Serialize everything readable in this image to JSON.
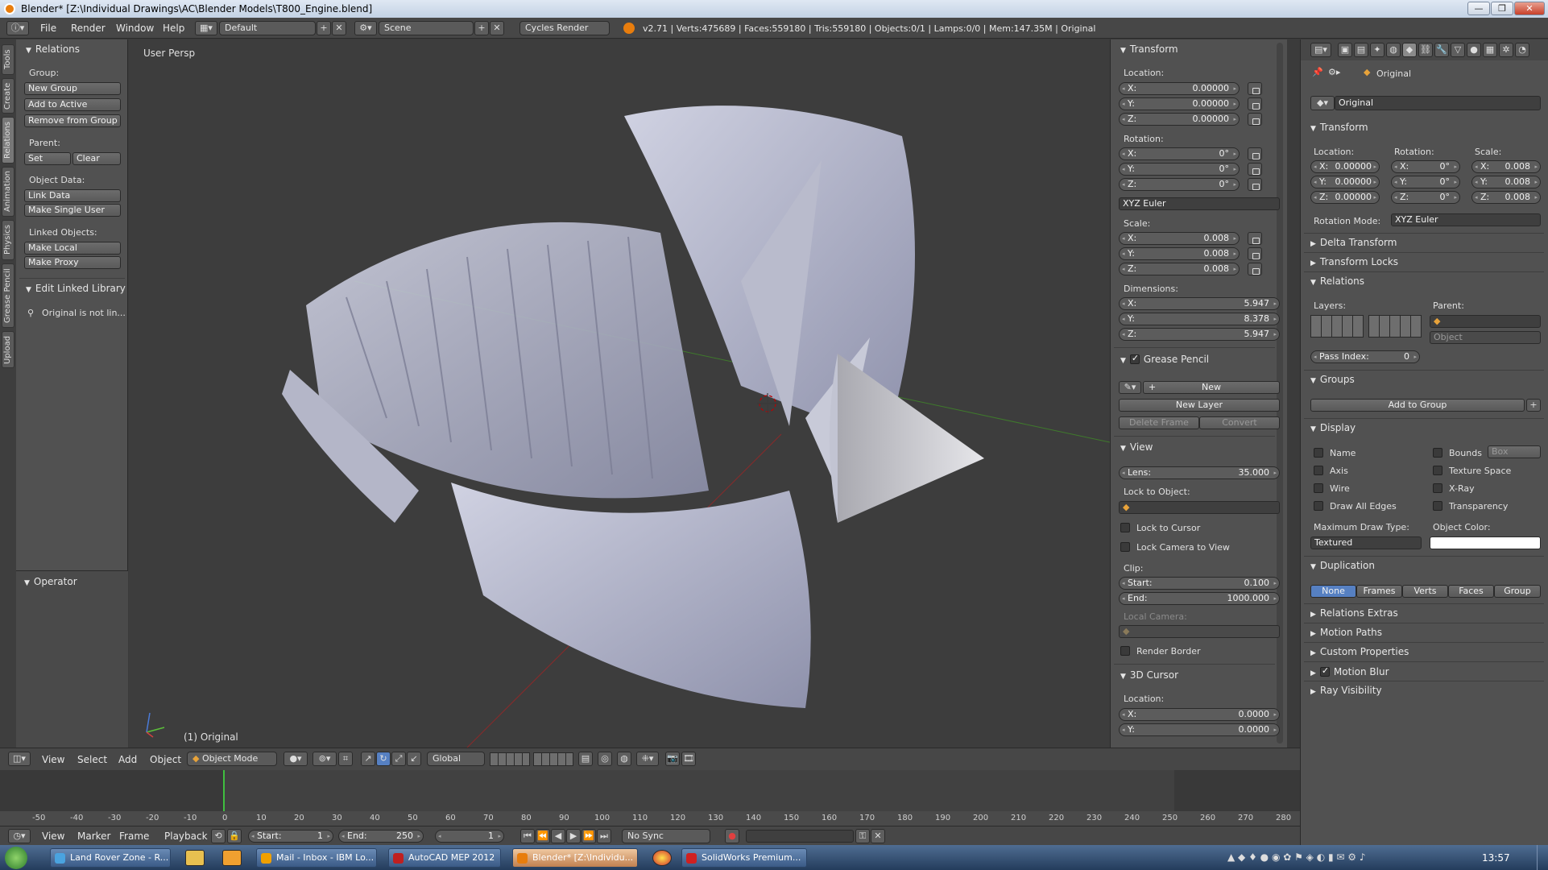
{
  "window": {
    "title": "Blender* [Z:\\Individual Drawings\\AC\\Blender Models\\T800_Engine.blend]"
  },
  "menubar": {
    "menus": [
      "File",
      "Render",
      "Window",
      "Help"
    ],
    "layout": "Default",
    "scene": "Scene",
    "engine": "Cycles Render",
    "stats": "v2.71 | Verts:475689 | Faces:559180 | Tris:559180 | Objects:0/1 | Lamps:0/0 | Mem:147.35M | Original"
  },
  "tool_tabs": [
    "Tools",
    "Create",
    "Relations",
    "Animation",
    "Physics",
    "Grease Pencil",
    "Upload"
  ],
  "toolshelf": {
    "relations_title": "Relations",
    "group_label": "Group:",
    "new_group": "New Group",
    "add_to_active": "Add to Active",
    "remove_from_group": "Remove from Group",
    "parent_label": "Parent:",
    "set": "Set",
    "clear": "Clear",
    "object_data_label": "Object Data:",
    "link_data": "Link Data",
    "make_single_user": "Make Single User",
    "linked_objects_label": "Linked Objects:",
    "make_local": "Make Local",
    "make_proxy": "Make Proxy",
    "edit_linked_title": "Edit Linked Library",
    "not_linked": "Original is not lin...",
    "operator_title": "Operator"
  },
  "viewport": {
    "view_name": "User Persp",
    "object_label": "(1) Original"
  },
  "npanel": {
    "transform_title": "Transform",
    "location_label": "Location:",
    "loc": [
      {
        "k": "X:",
        "v": "0.00000"
      },
      {
        "k": "Y:",
        "v": "0.00000"
      },
      {
        "k": "Z:",
        "v": "0.00000"
      }
    ],
    "rotation_label": "Rotation:",
    "rot": [
      {
        "k": "X:",
        "v": "0°"
      },
      {
        "k": "Y:",
        "v": "0°"
      },
      {
        "k": "Z:",
        "v": "0°"
      }
    ],
    "rotation_mode": "XYZ Euler",
    "scale_label": "Scale:",
    "scale": [
      {
        "k": "X:",
        "v": "0.008"
      },
      {
        "k": "Y:",
        "v": "0.008"
      },
      {
        "k": "Z:",
        "v": "0.008"
      }
    ],
    "dimensions_label": "Dimensions:",
    "dims": [
      {
        "k": "X:",
        "v": "5.947"
      },
      {
        "k": "Y:",
        "v": "8.378"
      },
      {
        "k": "Z:",
        "v": "5.947"
      }
    ],
    "grease_pencil_title": "Grease Pencil",
    "gp_new": "New",
    "gp_new_layer": "New Layer",
    "gp_delete_frame": "Delete Frame",
    "gp_convert": "Convert",
    "view_title": "View",
    "lens_k": "Lens:",
    "lens_v": "35.000",
    "lock_to_object": "Lock to Object:",
    "lock_to_cursor": "Lock to Cursor",
    "lock_camera": "Lock Camera to View",
    "clip_label": "Clip:",
    "clip_start_k": "Start:",
    "clip_start_v": "0.100",
    "clip_end_k": "End:",
    "clip_end_v": "1000.000",
    "local_camera": "Local Camera:",
    "render_border": "Render Border",
    "cursor_title": "3D Cursor",
    "cursor_location": "Location:",
    "cur": [
      {
        "k": "X:",
        "v": "0.0000"
      },
      {
        "k": "Y:",
        "v": "0.0000"
      }
    ]
  },
  "properties": {
    "breadcrumb": "Original",
    "object_name": "Original",
    "transform_title": "Transform",
    "location_label": "Location:",
    "rotation_label": "Rotation:",
    "scale_label": "Scale:",
    "loc": [
      {
        "k": "X:",
        "v": "0.00000"
      },
      {
        "k": "Y:",
        "v": "0.00000"
      },
      {
        "k": "Z:",
        "v": "0.00000"
      }
    ],
    "rot": [
      {
        "k": "X:",
        "v": "0°"
      },
      {
        "k": "Y:",
        "v": "0°"
      },
      {
        "k": "Z:",
        "v": "0°"
      }
    ],
    "scl": [
      {
        "k": "X:",
        "v": "0.008"
      },
      {
        "k": "Y:",
        "v": "0.008"
      },
      {
        "k": "Z:",
        "v": "0.008"
      }
    ],
    "rotation_mode_label": "Rotation Mode:",
    "rotation_mode": "XYZ Euler",
    "delta_transform": "Delta Transform",
    "transform_locks": "Transform Locks",
    "relations_title": "Relations",
    "layers_label": "Layers:",
    "parent_label": "Parent:",
    "parent_type": "Object",
    "pass_index_k": "Pass Index:",
    "pass_index_v": "0",
    "groups_title": "Groups",
    "add_to_group": "Add to Group",
    "display_title": "Display",
    "name": "Name",
    "bounds": "Bounds",
    "bounds_type": "Box",
    "axis": "Axis",
    "texture_space": "Texture Space",
    "wire": "Wire",
    "xray": "X-Ray",
    "draw_all_edges": "Draw All Edges",
    "transparency": "Transparency",
    "max_draw_type_label": "Maximum Draw Type:",
    "object_color_label": "Object Color:",
    "max_draw_type": "Textured",
    "object_color": "#ffffff",
    "duplication_title": "Duplication",
    "dup": [
      "None",
      "Frames",
      "Verts",
      "Faces",
      "Group"
    ],
    "relations_extras": "Relations Extras",
    "motion_paths": "Motion Paths",
    "custom_properties": "Custom Properties",
    "motion_blur": "Motion Blur",
    "ray_visibility": "Ray Visibility"
  },
  "view3d_header": {
    "menus": [
      "View",
      "Select",
      "Add",
      "Object"
    ],
    "mode": "Object Mode",
    "orientation": "Global"
  },
  "timeline": {
    "ticks": [
      "-50",
      "-40",
      "-30",
      "-20",
      "-10",
      "0",
      "10",
      "20",
      "30",
      "40",
      "50",
      "60",
      "70",
      "80",
      "90",
      "100",
      "110",
      "120",
      "130",
      "140",
      "150",
      "160",
      "170",
      "180",
      "190",
      "200",
      "210",
      "220",
      "230",
      "240",
      "250",
      "260",
      "270",
      "280"
    ],
    "menus": [
      "View",
      "Marker",
      "Frame",
      "Playback"
    ],
    "start_k": "Start:",
    "start_v": "1",
    "end_k": "End:",
    "end_v": "250",
    "current": "1",
    "sync": "No Sync"
  },
  "taskbar": {
    "items": [
      "Land Rover Zone - R...",
      "Mail - Inbox - IBM Lo...",
      "AutoCAD MEP 2012",
      "Blender* [Z:\\Individu...",
      "SolidWorks Premium..."
    ],
    "clock": "13:57"
  }
}
